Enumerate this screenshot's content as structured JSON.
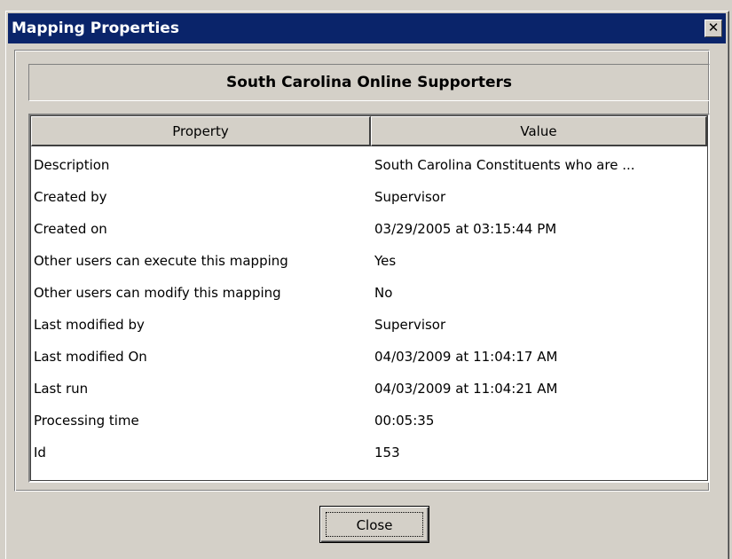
{
  "window": {
    "title": "Mapping Properties",
    "close_glyph": "✕"
  },
  "header": {
    "name": "South Carolina Online Supporters"
  },
  "grid": {
    "columns": [
      "Property",
      "Value"
    ],
    "rows": [
      {
        "property": "Description",
        "value": "South Carolina Constituents who are ..."
      },
      {
        "property": "Created by",
        "value": "Supervisor"
      },
      {
        "property": "Created on",
        "value": "03/29/2005 at 03:15:44 PM"
      },
      {
        "property": "Other users can execute this mapping",
        "value": "Yes"
      },
      {
        "property": "Other users can modify this mapping",
        "value": "No"
      },
      {
        "property": "Last modified by",
        "value": "Supervisor"
      },
      {
        "property": "Last modified On",
        "value": "04/03/2009 at 11:04:17 AM"
      },
      {
        "property": "Last run",
        "value": "04/03/2009 at 11:04:21 AM"
      },
      {
        "property": "Processing time",
        "value": "00:05:35"
      },
      {
        "property": "Id",
        "value": "153"
      }
    ]
  },
  "footer": {
    "close_label": "Close"
  },
  "colors": {
    "titlebar": "#0a246a",
    "face": "#d4d0c8"
  }
}
